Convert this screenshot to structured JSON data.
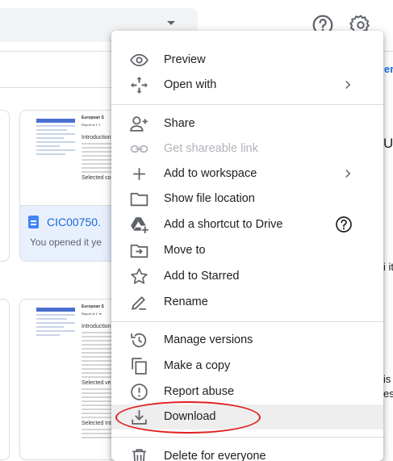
{
  "background": {
    "file_card": {
      "document": {
        "title": "European S",
        "subtitle": "Report of 1 Y",
        "section_heading": "Introduction",
        "section_heading_2": "Selected con"
      },
      "file_name": "CIC00750.",
      "file_subtitle": "You opened it ye"
    },
    "file_card_2": {
      "document": {
        "title": "European S",
        "subtitle": "Report of 1 Ye",
        "section_heading": "Introduction",
        "section_heading_2": "Selected vers",
        "section_heading_3": "Selected Intern"
      }
    },
    "edge_text": {
      "top_right": "er",
      "mid_right_1": "UI",
      "mid_right_2": "i it",
      "lower_right_1": "is",
      "lower_right_2": "ess"
    }
  },
  "header": {
    "help_icon": "help-circle-icon",
    "settings_icon": "gear-icon"
  },
  "menu": {
    "items": [
      {
        "label": "Preview",
        "icon": "eye-icon"
      },
      {
        "label": "Open with",
        "icon": "move-arrows-icon",
        "submenu": true
      },
      {
        "label": "Share",
        "icon": "person-add-icon"
      },
      {
        "label": "Get shareable link",
        "icon": "link-icon",
        "disabled": true
      },
      {
        "label": "Add to workspace",
        "icon": "plus-icon",
        "submenu": true
      },
      {
        "label": "Show file location",
        "icon": "folder-icon"
      },
      {
        "label": "Add a shortcut to Drive",
        "icon": "drive-shortcut-icon",
        "help": true
      },
      {
        "label": "Move to",
        "icon": "move-to-folder-icon"
      },
      {
        "label": "Add to Starred",
        "icon": "star-icon"
      },
      {
        "label": "Rename",
        "icon": "pencil-icon"
      },
      {
        "label": "Manage versions",
        "icon": "history-icon"
      },
      {
        "label": "Make a copy",
        "icon": "copy-icon"
      },
      {
        "label": "Report abuse",
        "icon": "alert-circle-icon"
      },
      {
        "label": "Download",
        "icon": "download-icon",
        "highlighted": true
      },
      {
        "label": "Delete for everyone",
        "icon": "trash-icon"
      }
    ],
    "highlight_color": "#e02020"
  }
}
